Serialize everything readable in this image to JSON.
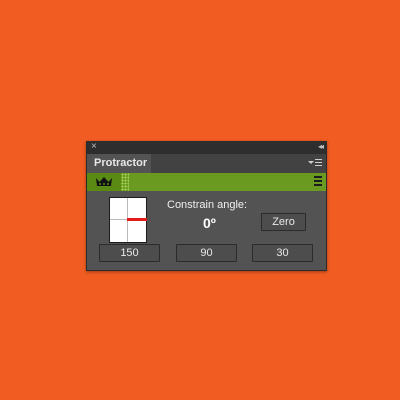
{
  "panel": {
    "title_tab": "Protractor",
    "close_glyph": "×",
    "collapse_glyph": "◂◂",
    "logo_icon": "crown-icon",
    "menu_icon": "panel-menu-icon",
    "hamburger_icon": "hamburger-icon",
    "accent_color": "#6a9a1f",
    "needle_color": "#e41b1b"
  },
  "constrain": {
    "label": "Constrain angle:",
    "value": "0º",
    "zero_button": "Zero"
  },
  "presets": [
    "150",
    "90",
    "30"
  ]
}
